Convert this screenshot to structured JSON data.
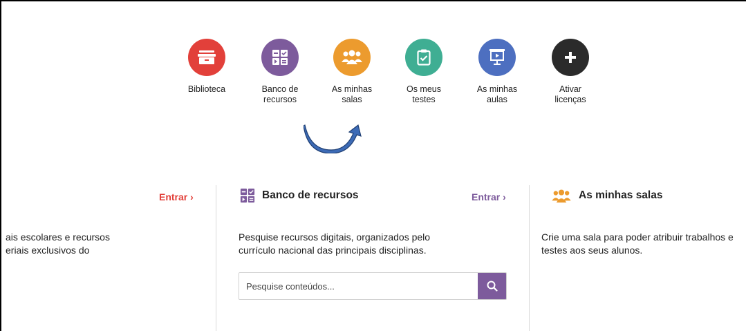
{
  "nav": [
    {
      "label": "Biblioteca",
      "color": "#e2403a",
      "icon": "archive-box-icon"
    },
    {
      "label": "Banco de\nrecursos",
      "color": "#7d5b9c",
      "icon": "resource-grid-icon"
    },
    {
      "label": "As minhas\nsalas",
      "color": "#ec9b2e",
      "icon": "people-group-icon"
    },
    {
      "label": "Os meus\ntestes",
      "color": "#3fae93",
      "icon": "clipboard-check-icon"
    },
    {
      "label": "As minhas\naulas",
      "color": "#4d6fc0",
      "icon": "presentation-board-icon"
    },
    {
      "label": "Ativar\nlicenças",
      "color": "#2b2b2b",
      "icon": "plus-icon"
    }
  ],
  "left_section": {
    "entrar": "Entrar ›",
    "desc": "ais escolares e recursos\neriais exclusivos do",
    "accent": "#e2403a"
  },
  "middle_section": {
    "title": "Banco de recursos",
    "entrar": "Entrar ›",
    "desc": "Pesquise recursos digitais, organizados pelo\ncurrículo nacional das principais disciplinas.",
    "search_placeholder": "Pesquise conteúdos...",
    "accent": "#7d5b9c"
  },
  "right_section": {
    "title": "As minhas salas",
    "desc": "Crie uma sala para poder atribuir trabalhos e\ntestes aos seus alunos.",
    "accent": "#ec9b2e"
  }
}
